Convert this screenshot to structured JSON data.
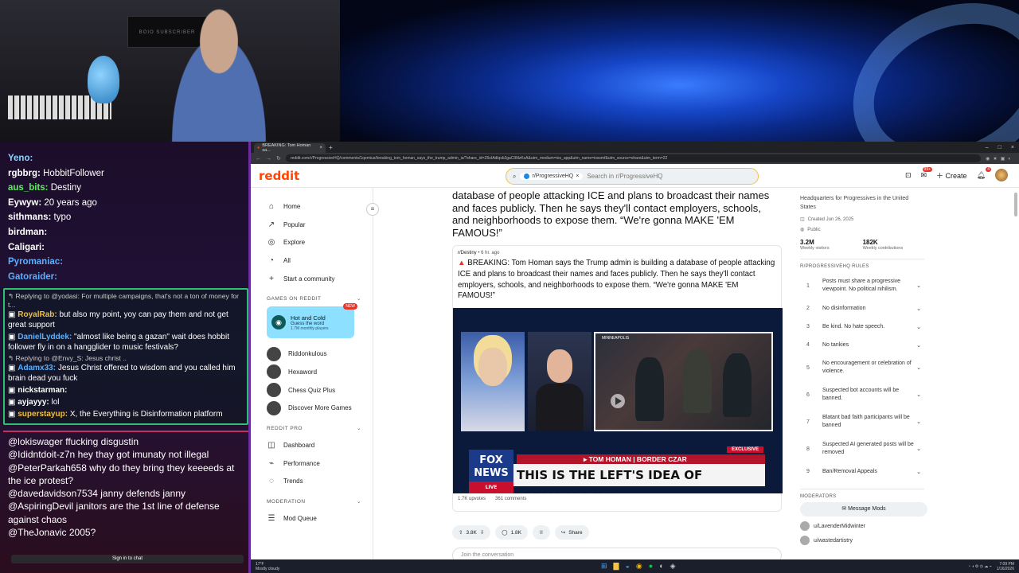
{
  "colors": {
    "reddit_orange": "#ff4500",
    "chat_green_border": "#2fbf71",
    "chat_red_border": "#c03060",
    "fox_red": "#c8102e"
  },
  "webcam": {
    "poster_text": "BOIO SUBSCRIBER"
  },
  "chat_top": [
    {
      "name": "Yeno:",
      "color": "#8fd3ff",
      "text": ""
    },
    {
      "name": "rgbbrg:",
      "color": "#ffffff",
      "text": "HobbitFollower"
    },
    {
      "name": "aus_bits:",
      "color": "#5af25a",
      "text": "Destiny"
    },
    {
      "name": "Eywyw:",
      "color": "#ffffff",
      "text": "20 years ago"
    },
    {
      "name": "sithmans:",
      "color": "#ffffff",
      "text": "typo"
    },
    {
      "name": "birdman:",
      "color": "#ffffff",
      "text": ""
    },
    {
      "name": "Caligari:",
      "color": "#ffffff",
      "text": ""
    },
    {
      "name": "Pyromaniac:",
      "color": "#5ab0ff",
      "text": ""
    },
    {
      "name": "Gatoraider:",
      "color": "#5ab0ff",
      "text": ""
    }
  ],
  "chat_mid": [
    {
      "reply": "Replying to @yodasi: For multiple campaigns, that's not a ton of money for t...",
      "name": "RoyalRab:",
      "color": "#f0c040",
      "text": "but also my point, yoy can pay them and not get great support"
    },
    {
      "reply": "",
      "name": "DanielLyddek:",
      "color": "#5ab0ff",
      "text": "\"almost like being a gazan\" wait does hobbit follower fly in on a hangglider to music festivals?"
    },
    {
      "reply": "Replying to @Envy_S: Jesus christ ..",
      "name": "Adamx33:",
      "color": "#5ab0ff",
      "text": "Jesus Christ offered to wisdom and you called him brain dead you fuck"
    },
    {
      "reply": "",
      "name": "nickstarman:",
      "color": "#ffffff",
      "text": ""
    },
    {
      "reply": "",
      "name": "ayjayyy:",
      "color": "#ffffff",
      "text": "lol"
    },
    {
      "reply": "",
      "name": "superstayup:",
      "color": "#f0c040",
      "text": "X, the Everything is Disinformation platform"
    }
  ],
  "chat_bottom": [
    "@lokiswager ffucking disgustin",
    "@Ididntdoit-z7n hey thay got imunaty not illegal",
    "@PeterParkah658 why do they bring they keeeeds at the ice protest?",
    "@davedavidson7534 janny defends janny",
    "@AspiringDevil janitors are the 1st line of defense against chaos",
    "@TheJonavic 2005?"
  ],
  "chat_signin": "Sign in to chat",
  "browser": {
    "tab_title": "BREAKING: Tom Homan sa...",
    "url": "reddit.com/r/ProgressiveHQ/comments/1qemius/breaking_tom_homan_says_the_trump_admin_is/?share_id=Z6sIAdlqsb2gaCI8ilzKxA&utm_medium=ios_app&utm_name=iossmf&utm_source=share&utm_term=22"
  },
  "reddit": {
    "logo": "reddit",
    "search_chip": "r/ProgressiveHQ",
    "search_placeholder": "Search in r/ProgressiveHQ",
    "create_label": "Create",
    "notif_badge": "99+",
    "bell_badge": "4",
    "nav": [
      {
        "icon": "home-icon",
        "glyph": "⌂",
        "label": "Home"
      },
      {
        "icon": "popular-icon",
        "glyph": "↗",
        "label": "Popular"
      },
      {
        "icon": "explore-icon",
        "glyph": "◎",
        "label": "Explore"
      },
      {
        "icon": "all-icon",
        "glyph": "◔",
        "label": "All"
      },
      {
        "icon": "plus-icon",
        "glyph": "+",
        "label": "Start a community"
      }
    ],
    "games_section": "GAMES ON REDDIT",
    "featured_game": {
      "title": "Hot and Cold",
      "subtitle": "Guess the word",
      "players": "1.7M monthly players",
      "tag": "NEW"
    },
    "games": [
      "Riddonkulous",
      "Hexaword",
      "Chess Quiz Plus",
      "Discover More Games"
    ],
    "pro_section": "REDDIT PRO",
    "pro_items": [
      "Dashboard",
      "Performance",
      "Trends"
    ],
    "mod_section": "MODERATION",
    "mod_items": [
      "Mod Queue"
    ]
  },
  "post": {
    "headline": "database of people attacking ICE and plans to broadcast their names and faces publicly. Then he says they'll contact employers, schools, and neighborhoods to expose them. “We're gonna MAKE 'EM FAMOUS!”",
    "xpost_sub": "r/Destiny",
    "xpost_time": "• 6 hr. ago",
    "xpost_title": "BREAKING: Tom Homan says the Trump admin is building a database of people attacking ICE and plans to broadcast their names and faces publicly. Then he says they'll contact employers, schools, and neighborhoods to expose them. “We're gonna MAKE 'EM FAMOUS!”",
    "video": {
      "location": "MINNEAPOLIS",
      "exclusive": "EXCLUSIVE",
      "nameplate": "▸ TOM HOMAN | BORDER CZAR",
      "chyron": "THIS IS THE LEFT'S IDEA OF \"DEMOCRACY\"",
      "network": "FOX NEWS",
      "live": "LIVE"
    },
    "xpost_upvotes": "1.7K upvotes",
    "xpost_comments": "361 comments",
    "votes": "3.8K",
    "comments": "1.8K",
    "share": "Share",
    "comment_placeholder": "Join the conversation"
  },
  "sidebar": {
    "description": "Headquarters for Progressives in the United States",
    "created": "Created Jun 26, 2025",
    "visibility": "Public",
    "visitors_value": "3.2M",
    "visitors_label": "Weekly visitors",
    "contrib_value": "182K",
    "contrib_label": "Weekly contributions",
    "rules_title": "R/PROGRESSIVEHQ RULES",
    "rules": [
      {
        "n": "1",
        "t": "Posts must share a progressive viewpoint. No political nihilism."
      },
      {
        "n": "2",
        "t": "No disinformation"
      },
      {
        "n": "3",
        "t": "Be kind. No hate speech."
      },
      {
        "n": "4",
        "t": "No tankies"
      },
      {
        "n": "5",
        "t": "No encouragement or celebration of violence."
      },
      {
        "n": "6",
        "t": "Suspected bot accounts will be banned."
      },
      {
        "n": "7",
        "t": "Blatant bad faith participants will be banned"
      },
      {
        "n": "8",
        "t": "Suspected AI generated posts will be removed"
      },
      {
        "n": "9",
        "t": "Ban/Removal Appeals"
      }
    ],
    "moderators_title": "MODERATORS",
    "message_mods": "Message Mods",
    "moderators": [
      "u/LavenderMidwinter",
      "u/wastedartistry"
    ]
  },
  "taskbar": {
    "weather_temp": "17°F",
    "weather_desc": "Mostly cloudy",
    "time": "7:09 PM",
    "date": "1/16/2026"
  }
}
